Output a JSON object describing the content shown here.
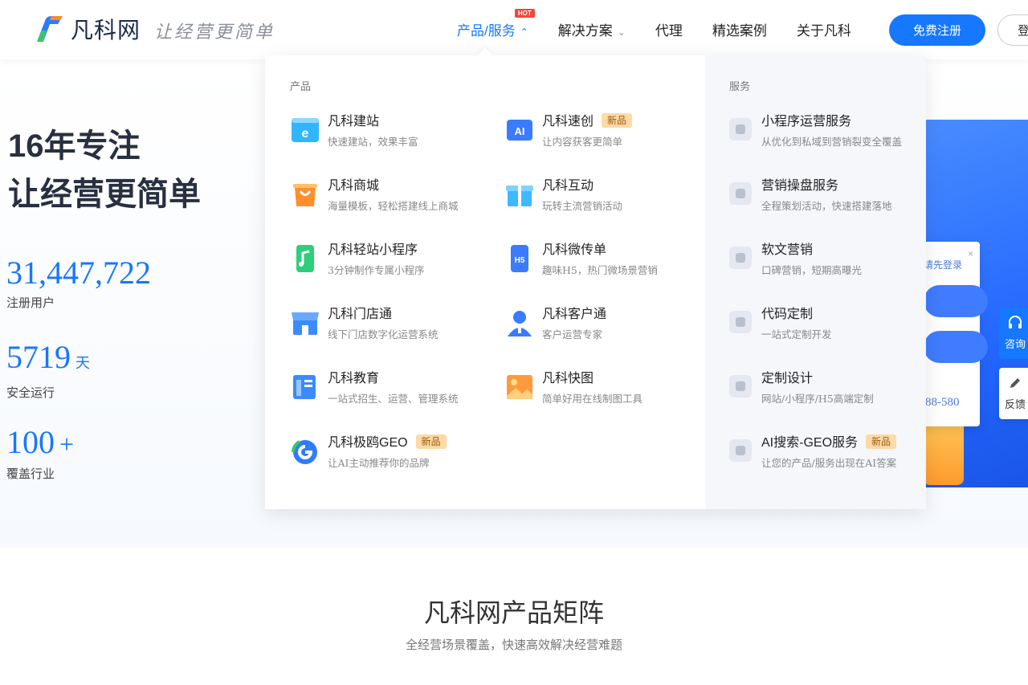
{
  "header": {
    "logo_text": "凡科网",
    "slogan": "让经营更简单",
    "nav": [
      {
        "label": "产品/服务",
        "hot": "HOT",
        "caret": "⌃"
      },
      {
        "label": "解决方案",
        "caret": "⌄"
      },
      {
        "label": "代理"
      },
      {
        "label": "精选案例"
      },
      {
        "label": "关于凡科"
      }
    ],
    "register_label": "免费注册",
    "login_label": "登"
  },
  "hero": {
    "title_line1": "16年专注",
    "title_line2": "让经营更简单",
    "stats": [
      {
        "value": "31,447,722",
        "unit": "",
        "label": "注册用户"
      },
      {
        "value": "5719",
        "unit": "天",
        "label": "安全运行"
      },
      {
        "value": "100",
        "unit": "+",
        "label": "覆盖行业"
      }
    ],
    "login_card": {
      "text": "请先登录",
      "close": "×",
      "phone": "88-580"
    },
    "side": {
      "consult": "咨询",
      "feedback": "反馈"
    }
  },
  "dropdown": {
    "products_heading": "产品",
    "services_heading": "服务",
    "products": [
      {
        "name": "凡科建站",
        "desc": "快速建站，效果丰富",
        "badge": ""
      },
      {
        "name": "凡科速创",
        "desc": "让内容获客更简单",
        "badge": "新品"
      },
      {
        "name": "凡科商城",
        "desc": "海量模板，轻松搭建线上商城",
        "badge": ""
      },
      {
        "name": "凡科互动",
        "desc": "玩转主流营销活动",
        "badge": ""
      },
      {
        "name": "凡科轻站小程序",
        "desc": "3分钟制作专属小程序",
        "badge": ""
      },
      {
        "name": "凡科微传单",
        "desc": "趣味H5，热门微场景营销",
        "badge": ""
      },
      {
        "name": "凡科门店通",
        "desc": "线下门店数字化运营系统",
        "badge": ""
      },
      {
        "name": "凡科客户通",
        "desc": "客户运营专家",
        "badge": ""
      },
      {
        "name": "凡科教育",
        "desc": "一站式招生、运营、管理系统",
        "badge": ""
      },
      {
        "name": "凡科快图",
        "desc": "简单好用在线制图工具",
        "badge": ""
      },
      {
        "name": "凡科极鸥GEO",
        "desc": "让AI主动推荐你的品牌",
        "badge": "新品"
      }
    ],
    "services": [
      {
        "name": "小程序运营服务",
        "desc": "从优化到私域到营销裂变全覆盖",
        "badge": ""
      },
      {
        "name": "营销操盘服务",
        "desc": "全程策划活动，快速搭建落地",
        "badge": ""
      },
      {
        "name": "软文营销",
        "desc": "口碑营销，短期高曝光",
        "badge": ""
      },
      {
        "name": "代码定制",
        "desc": "一站式定制开发",
        "badge": ""
      },
      {
        "name": "定制设计",
        "desc": "网站/小程序/H5高端定制",
        "badge": ""
      },
      {
        "name": "AI搜索-GEO服务",
        "desc": "让您的产品/服务出现在AI答案",
        "badge": "新品"
      }
    ]
  },
  "section": {
    "title": "凡科网产品矩阵",
    "subtitle": "全经营场景覆盖，快速高效解决经营难题"
  },
  "colors": {
    "accent": "#1677ff",
    "hot": "#f5453a",
    "badge_bg": "#ffd9a6"
  }
}
